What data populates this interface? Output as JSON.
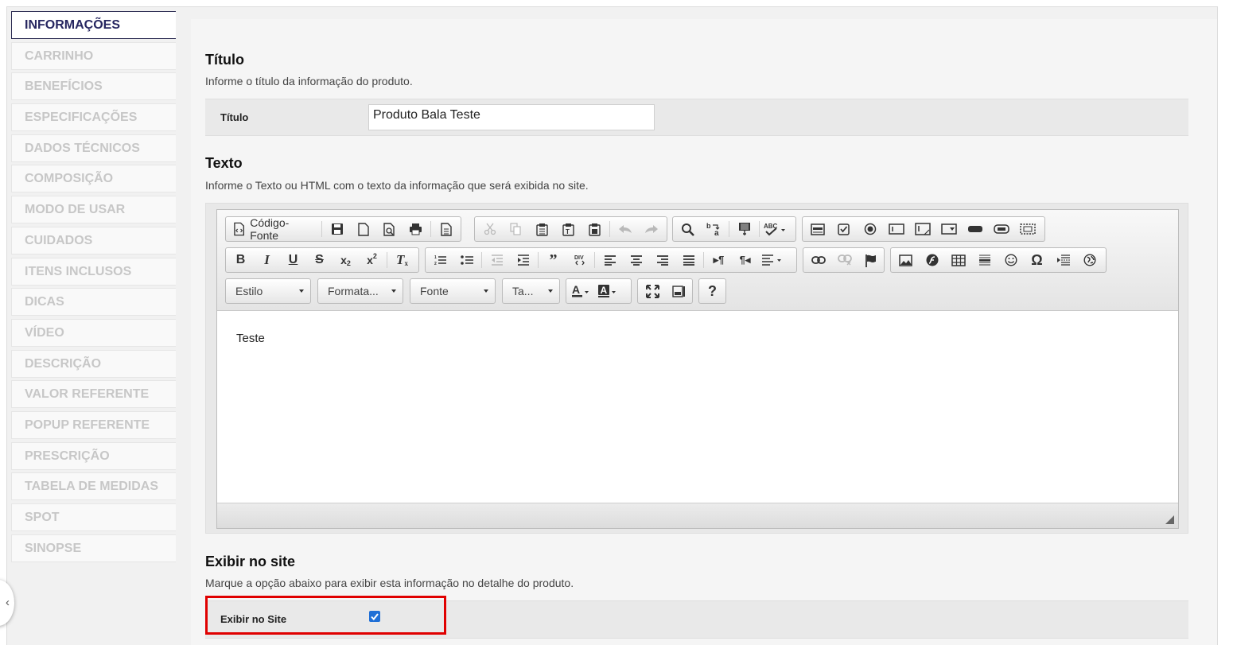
{
  "sidebar": {
    "tabs": [
      {
        "label": "INFORMAÇÕES",
        "active": true
      },
      {
        "label": "CARRINHO"
      },
      {
        "label": "BENEFÍCIOS"
      },
      {
        "label": "ESPECIFICAÇÕES"
      },
      {
        "label": "DADOS TÉCNICOS"
      },
      {
        "label": "COMPOSIÇÃO"
      },
      {
        "label": "MODO DE USAR"
      },
      {
        "label": "CUIDADOS"
      },
      {
        "label": "ITENS INCLUSOS"
      },
      {
        "label": "DICAS"
      },
      {
        "label": "VÍDEO"
      },
      {
        "label": "DESCRIÇÃO"
      },
      {
        "label": "VALOR REFERENTE"
      },
      {
        "label": "POPUP REFERENTE"
      },
      {
        "label": "PRESCRIÇÃO"
      },
      {
        "label": "TABELA DE MEDIDAS"
      },
      {
        "label": "SPOT"
      },
      {
        "label": "SINOPSE"
      }
    ],
    "collapse_glyph": "‹"
  },
  "titulo": {
    "heading": "Título",
    "description": "Informe o título da informação do produto.",
    "field_label": "Título",
    "value": "Produto Bala Teste"
  },
  "texto": {
    "heading": "Texto",
    "description": "Informe o Texto ou HTML com o texto da informação que será exibida no site.",
    "editor": {
      "source_button_label": "Código-Fonte",
      "combos": {
        "style": "Estilo",
        "format": "Formata...",
        "font": "Fonte",
        "size": "Ta..."
      },
      "help_label": "?",
      "content": "Teste"
    }
  },
  "exibir": {
    "heading": "Exibir no site",
    "description": "Marque a opção abaixo para exibir esta informação no detalhe do produto.",
    "field_label": "Exibir no Site",
    "checked": true
  },
  "colors": {
    "highlight_border": "#e00000",
    "checkbox_fill": "#1f6fd6",
    "active_tab_text": "#262660",
    "inactive_tab_text": "#c7c7c7"
  }
}
